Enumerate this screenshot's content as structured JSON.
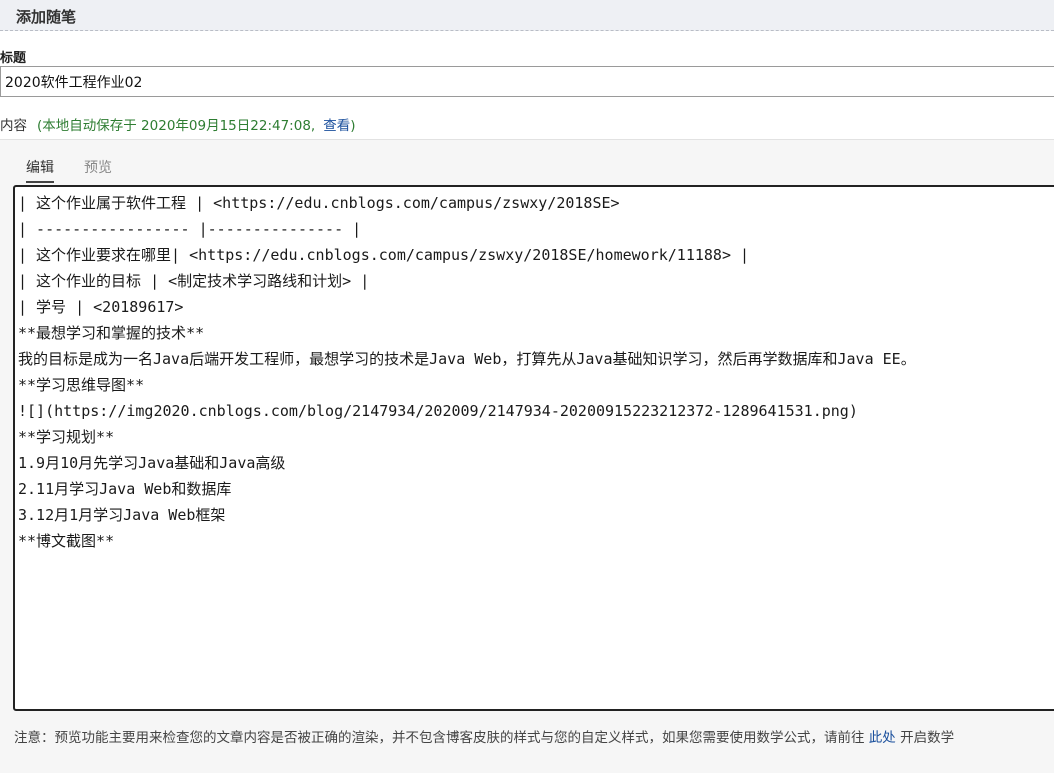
{
  "header": {
    "title": "添加随笔"
  },
  "title_field": {
    "label": "标题",
    "value": "2020软件工程作业02"
  },
  "content": {
    "label": "内容",
    "autosave_prefix": "(本地自动保存于 2020年09月15日22:47:08,",
    "autosave_link": "查看",
    "autosave_suffix": ")"
  },
  "tabs": [
    {
      "label": "编辑",
      "active": true
    },
    {
      "label": "预览",
      "active": false
    }
  ],
  "editor": {
    "text": "| 这个作业属于软件工程 | <https://edu.cnblogs.com/campus/zswxy/2018SE>\n| ----------------- |--------------- |\n| 这个作业要求在哪里| <https://edu.cnblogs.com/campus/zswxy/2018SE/homework/11188> |\n| 这个作业的目标 | <制定技术学习路线和计划> |\n| 学号 | <20189617>\n**最想学习和掌握的技术**\n我的目标是成为一名Java后端开发工程师，最想学习的技术是Java Web，打算先从Java基础知识学习，然后再学数据库和Java EE。\n**学习思维导图**\n![](https://img2020.cnblogs.com/blog/2147934/202009/2147934-20200915223212372-1289641531.png)\n**学习规划**\n1.9月10月先学习Java基础和Java高级\n2.11月学习Java Web和数据库\n3.12月1月学习Java Web框架\n**博文截图**"
  },
  "note": {
    "text": "注意：预览功能主要用来检查您的文章内容是否被正确的渲染，并不包含博客皮肤的样式与您的自定义样式，如果您需要使用数学公式，请前往",
    "link": "此处",
    "suffix": "开启数学"
  },
  "colors": {
    "accent_link": "#1a4f9c",
    "autosave_green": "#2e7d32",
    "header_bg": "#eef0f4"
  }
}
